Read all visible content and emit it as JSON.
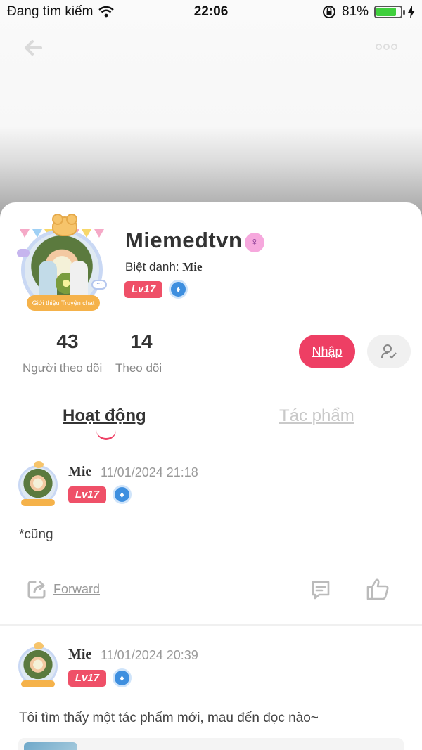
{
  "status_bar": {
    "carrier": "Đang tìm kiếm",
    "time": "22:06",
    "battery": "81%",
    "battery_level": 0.81
  },
  "nav": {
    "back_icon": "arrow-left-icon",
    "more_icon": "more-dots-icon"
  },
  "profile": {
    "username": "Miemedtvn",
    "gender_icon": "female-symbol-icon",
    "nickname_label": "Biệt danh: ",
    "nickname_value": "Mie",
    "level": "Lv17",
    "avatar_frame_tag": "Giới thiệu Truyện chat",
    "avatar_bubble": "···"
  },
  "stats": {
    "followers_count": "43",
    "followers_label": "Người theo dõi",
    "following_count": "14",
    "following_label": "Theo dõi"
  },
  "actions": {
    "follow_label": "Nhập",
    "profile_icon": "user-check-icon"
  },
  "tabs": [
    {
      "label": "Hoạt động",
      "active": true
    },
    {
      "label": "Tác phẩm",
      "active": false
    }
  ],
  "posts": [
    {
      "author": "Mie",
      "time": "11/01/2024 21:18",
      "level": "Lv17",
      "text": "*cũng",
      "forward_label": "Forward"
    },
    {
      "author": "Mie",
      "time": "11/01/2024 20:39",
      "level": "Lv17",
      "text": "Tôi tìm thấy một tác phẩm mới, mau đến đọc nào~"
    }
  ],
  "colors": {
    "accent": "#ee3f64",
    "level_badge": "#ef5068",
    "drop_badge": "#3e8fdf"
  }
}
